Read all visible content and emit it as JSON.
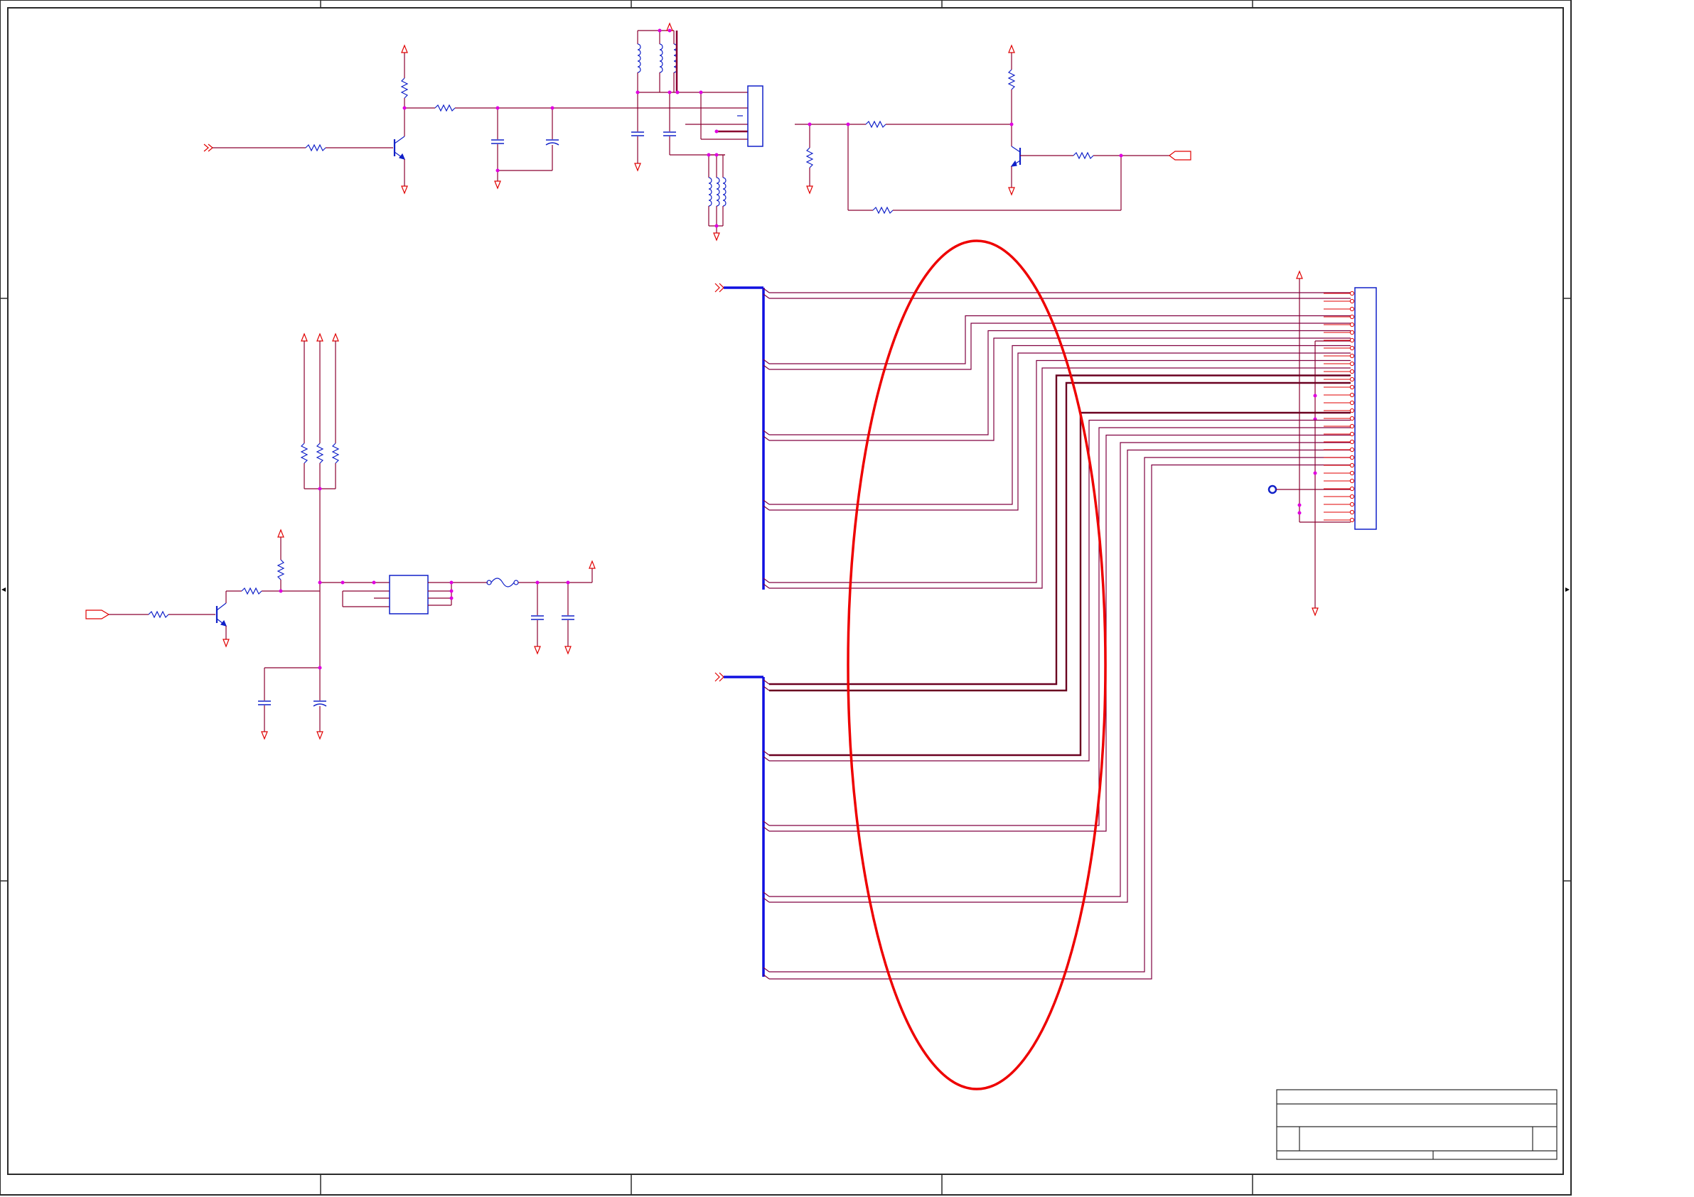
{
  "schematic": {
    "title_block": {
      "title": "",
      "subtitle": "",
      "sheet": ""
    },
    "colors": {
      "background": "#ffffff",
      "wire": "#8b0030",
      "net_trace": "#800040",
      "power_symbol": "#e00000",
      "component": "#1020c8",
      "junction": "#e000e0",
      "bus": "#1010e0",
      "border": "#2a2a2a",
      "highlight_ellipse": "#ee0000"
    },
    "icons": {
      "power": "power-arrow-up-icon",
      "ground": "ground-arrow-down-icon",
      "off_page": "off-page-connector-icon",
      "bus_entry": "bus-entry-icon",
      "resistor": "resistor-icon",
      "capacitor": "capacitor-icon",
      "transistor": "npn-transistor-icon",
      "inductor": "inductor-icon",
      "fuse": "fuse-icon",
      "test_point": "test-point-icon",
      "connector": "connector-icon"
    },
    "connector_pin_count": 30,
    "bus_groups": 2
  }
}
